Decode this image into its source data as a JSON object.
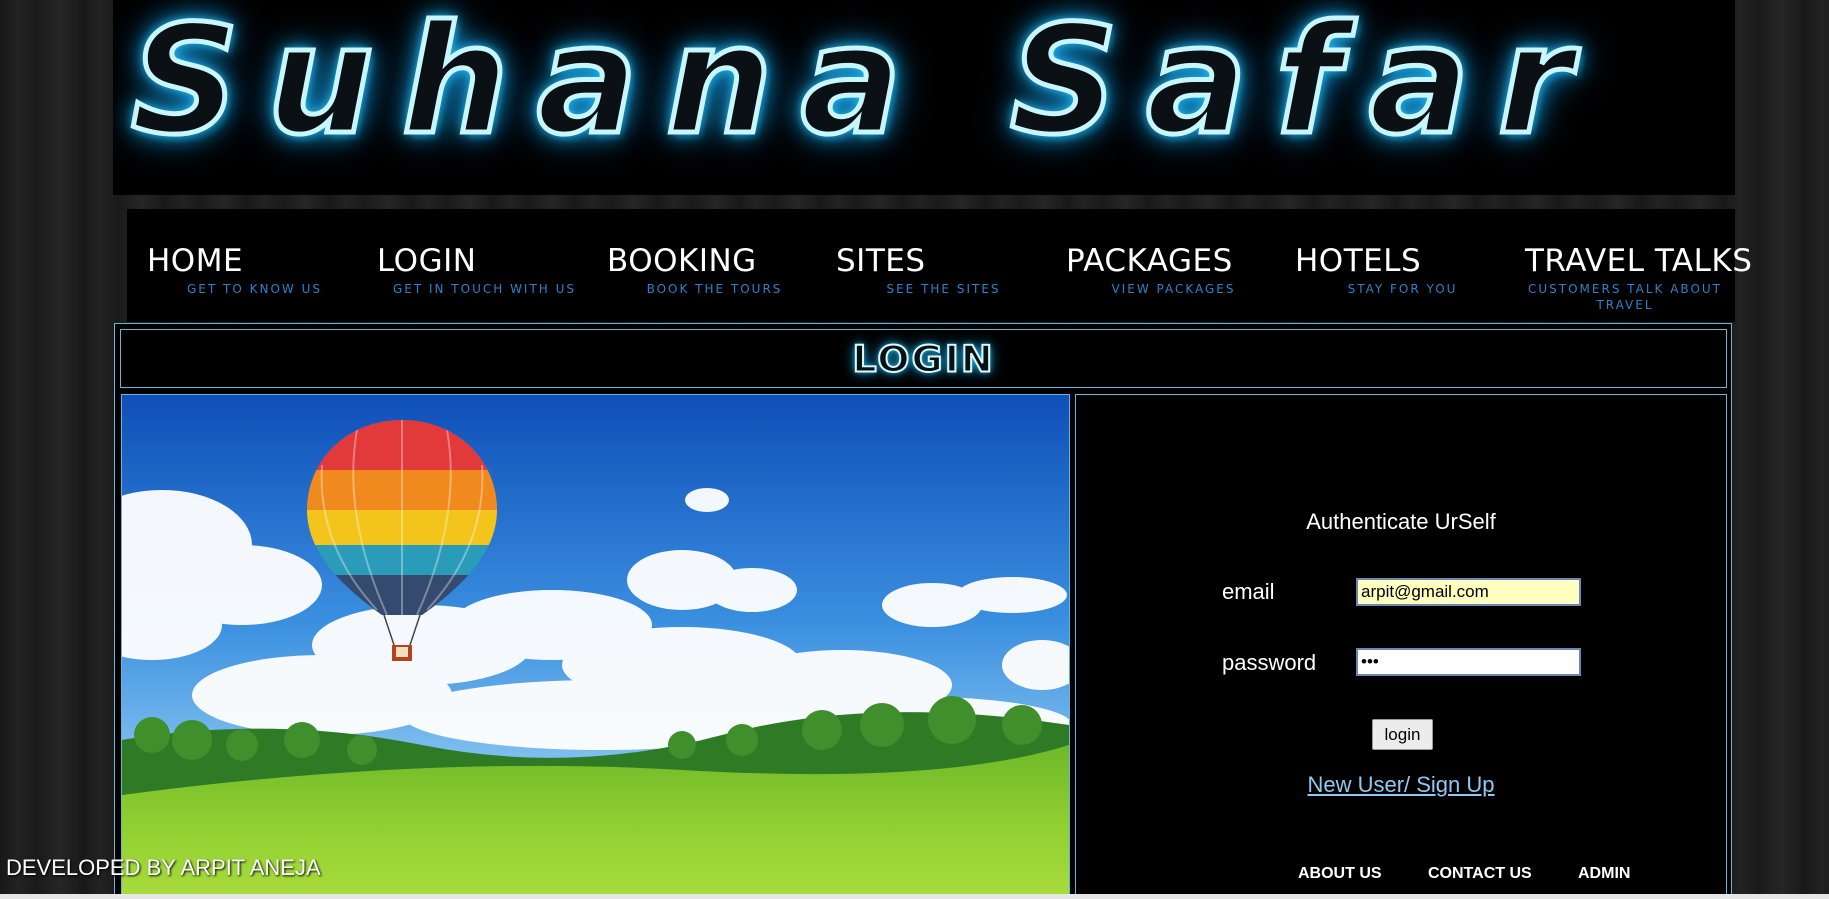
{
  "banner": {
    "title": "Suhana Safar"
  },
  "nav": {
    "items": [
      {
        "label": "HOME",
        "sub": "GET TO KNOW US"
      },
      {
        "label": "LOGIN",
        "sub": "GET IN TOUCH WITH US"
      },
      {
        "label": "BOOKING",
        "sub": "BOOK THE TOURS"
      },
      {
        "label": "SITES",
        "sub": "SEE THE SITES"
      },
      {
        "label": "PACKAGES",
        "sub": "VIEW PACKAGES"
      },
      {
        "label": "HOTELS",
        "sub": "STAY FOR YOU"
      },
      {
        "label": "TRAVEL TALKS",
        "sub": "CUSTOMERS TALK ABOUT TRAVEL"
      }
    ]
  },
  "section": {
    "title": "LOGIN"
  },
  "form": {
    "heading": "Authenticate UrSelf",
    "email_label": "email",
    "email_value": "arpit@gmail.com",
    "password_label": "password",
    "password_value": "•••",
    "login_button": "login",
    "signup_link": "New User/ Sign Up"
  },
  "footer": {
    "about": "ABOUT US",
    "contact": "CONTACT US",
    "admin": "ADMIN",
    "credit": "DEVELOPED BY ARPIT ANEJA"
  },
  "colors": {
    "accent": "#5fb9d6",
    "nav_sub": "#2a82c8",
    "link": "#8ec9f2",
    "email_bg": "#ffffc0",
    "neon": "#2ec8ff"
  },
  "image": {
    "description_icon": "hot-air-balloon-landscape"
  }
}
